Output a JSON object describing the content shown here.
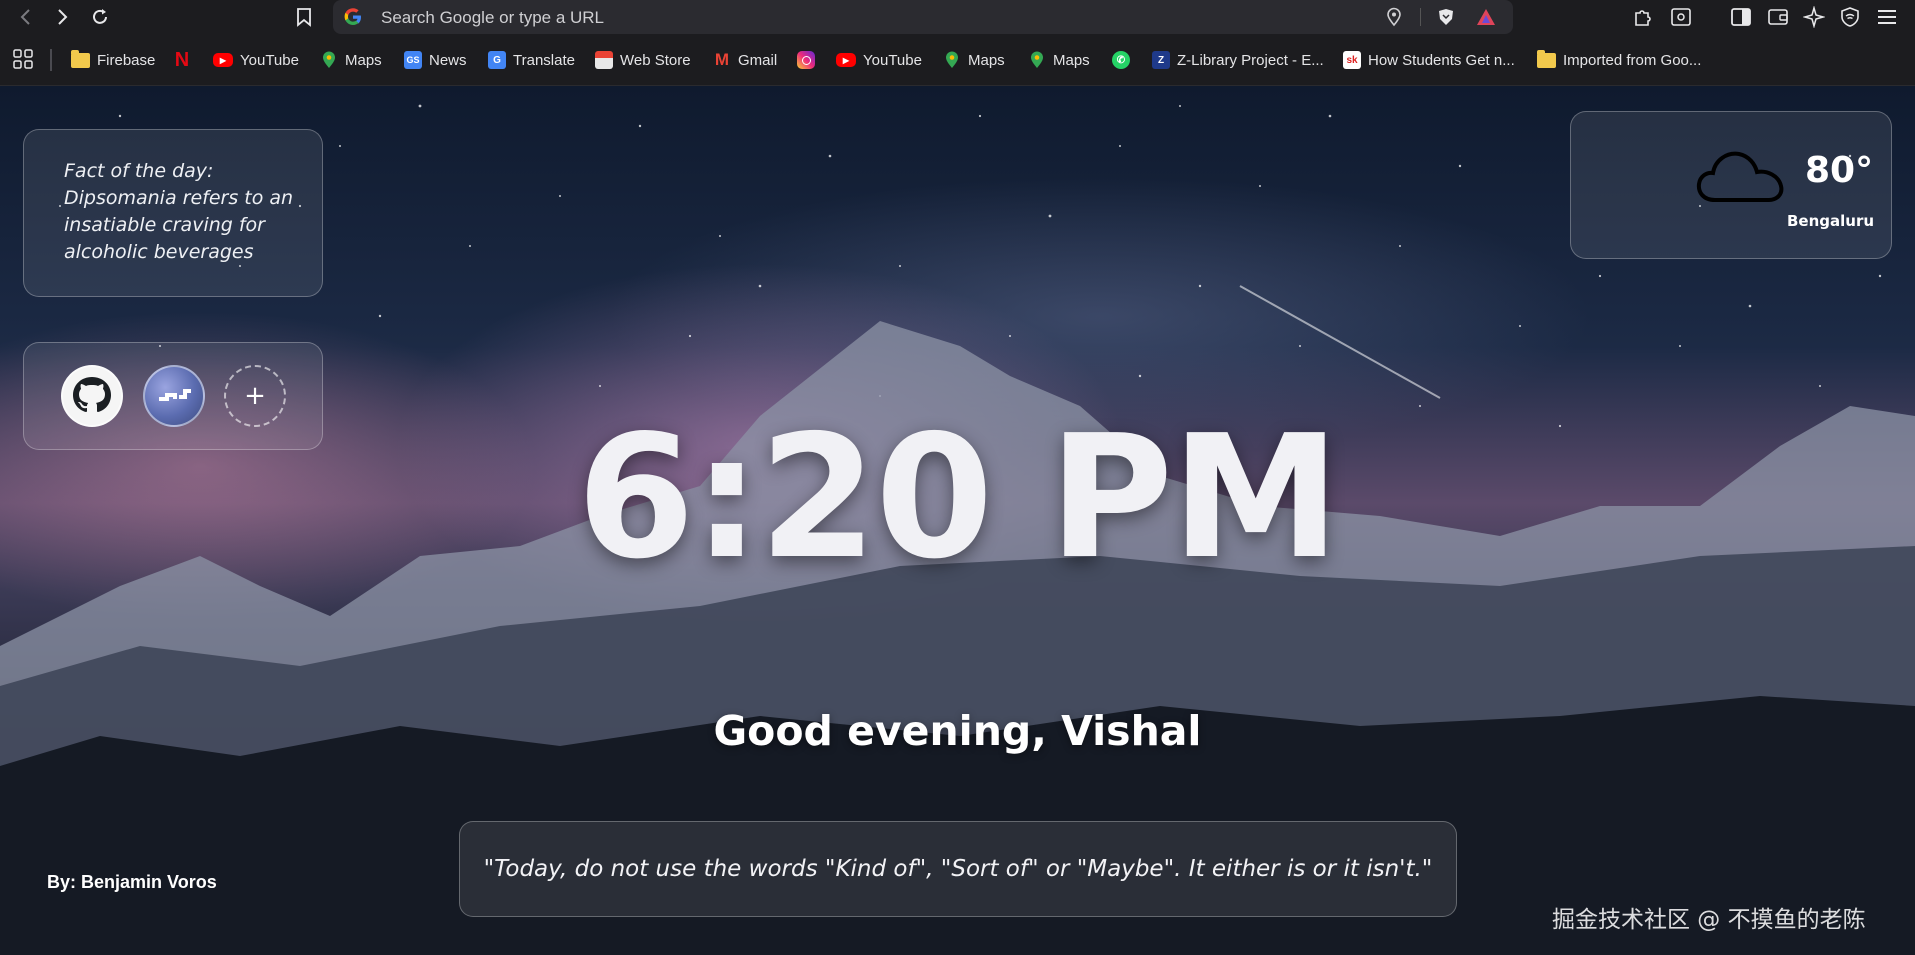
{
  "browser": {
    "omnibox_placeholder": "Search Google or type a URL",
    "accent": "#2b2b30"
  },
  "bookmarks": [
    {
      "label": "Firebase",
      "icon": "folder-icon"
    },
    {
      "label": "",
      "icon": "netflix-icon"
    },
    {
      "label": "YouTube",
      "icon": "youtube-icon"
    },
    {
      "label": "Maps",
      "icon": "maps-icon"
    },
    {
      "label": "News",
      "icon": "news-icon"
    },
    {
      "label": "Translate",
      "icon": "translate-icon"
    },
    {
      "label": "Web Store",
      "icon": "webstore-icon"
    },
    {
      "label": "Gmail",
      "icon": "gmail-icon"
    },
    {
      "label": "",
      "icon": "instagram-icon"
    },
    {
      "label": "YouTube",
      "icon": "youtube-icon"
    },
    {
      "label": "Maps",
      "icon": "maps-icon"
    },
    {
      "label": "Maps",
      "icon": "maps-icon"
    },
    {
      "label": "",
      "icon": "whatsapp-icon"
    },
    {
      "label": "Z-Library Project - E...",
      "icon": "zlibrary-icon"
    },
    {
      "label": "How Students Get n...",
      "icon": "sk-icon"
    },
    {
      "label": "Imported from Goo...",
      "icon": "folder-icon"
    }
  ],
  "fact": {
    "heading": "Fact of the day:",
    "text": "Dipsomania refers to an insatiable craving for alcoholic beverages"
  },
  "shortcuts": {
    "add_label": "+"
  },
  "weather": {
    "temperature": "80°",
    "city": "Bengaluru",
    "icon": "cloud-icon"
  },
  "clock": {
    "time": "6:20 PM"
  },
  "greeting": "Good evening, Vishal",
  "quote": "\"Today, do not use the words \"Kind of\", \"Sort of\" or \"Maybe\". It either is or it isn't.\"",
  "photo_credit": "By: Benjamin Voros",
  "watermark": "掘金技术社区 @ 不摸鱼的老陈"
}
